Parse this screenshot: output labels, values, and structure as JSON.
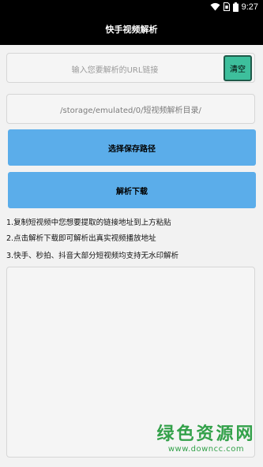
{
  "status_bar": {
    "time": "9:27",
    "icons": [
      "wifi-icon",
      "sim-icon",
      "battery-icon"
    ]
  },
  "header": {
    "title": "快手视频解析"
  },
  "url_input": {
    "placeholder": "输入您要解析的URL链接",
    "value": ""
  },
  "clear_button": {
    "label": "清空"
  },
  "save_path": {
    "value": "/storage/emulated/0/短视频解析目录/"
  },
  "buttons": {
    "choose_path": "选择保存路径",
    "parse_download": "解析下载"
  },
  "instructions": [
    "1.复制短视频中您想要提取的链接地址到上方粘贴",
    "2.点击解析下载即可解析出真实视频播放地址",
    "3.快手、秒拍、抖音大部分短视频均支持无水印解析"
  ],
  "watermark": {
    "title": "绿色资源网",
    "url": "www.downcc.com"
  },
  "colors": {
    "header_bg": "#000000",
    "button_blue": "#5badea",
    "clear_green": "#3dbf9c",
    "watermark_green": "#33a14a"
  }
}
